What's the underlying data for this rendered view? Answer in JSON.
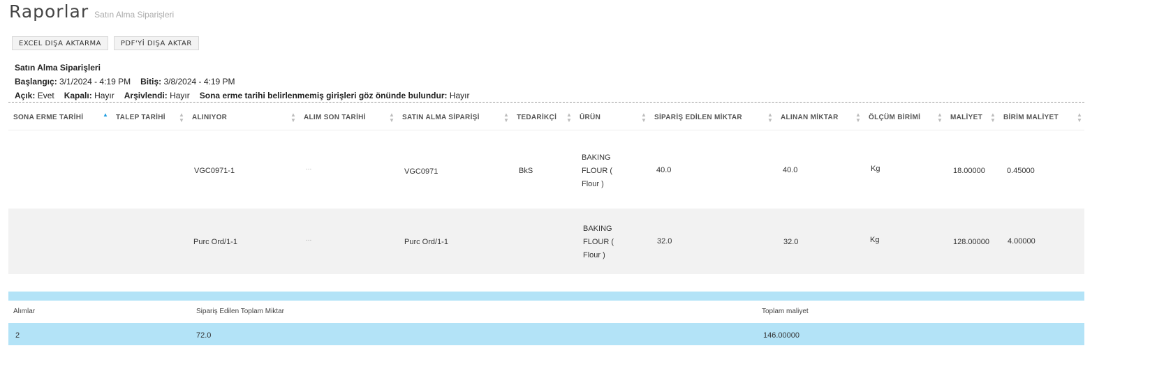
{
  "header": {
    "title": "Raporlar",
    "subtitle": "Satın Alma Siparişleri"
  },
  "toolbar": {
    "excel_label": "EXCEL DIŞA AKTARMA",
    "pdf_label": "PDF'Yİ DIŞA AKTAR"
  },
  "report": {
    "title": "Satın Alma Siparişleri",
    "start_label": "Başlangıç:",
    "start_value": "3/1/2024 - 4:19 PM",
    "end_label": "Bitiş:",
    "end_value": "3/8/2024 - 4:19 PM",
    "open_label": "Açık:",
    "open_value": "Evet",
    "closed_label": "Kapalı:",
    "closed_value": "Hayır",
    "archived_label": "Arşivlendi:",
    "archived_value": "Hayır",
    "noexp_label": "Sona erme tarihi belirlenmemiş girişleri göz önünde bulundur:",
    "noexp_value": "Hayır"
  },
  "table": {
    "columns": [
      "SONA ERME TARİHİ",
      "TALEP TARİHİ",
      "ALINIYOR",
      "ALIM SON TARİHİ",
      "SATIN ALMA SİPARİŞİ",
      "TEDARİKÇİ",
      "ÜRÜN",
      "SİPARİŞ EDİLEN MİKTAR",
      "ALINAN MİKTAR",
      "ÖLÇÜM BİRİMİ",
      "MALİYET",
      "BİRİM MALİYET"
    ],
    "rows": [
      {
        "expiry": "",
        "request": "",
        "receiving": "VGC0971-1",
        "deadline": "...",
        "po": "VGC0971",
        "supplier": "BkS",
        "product": "BAKING FLOUR ( Flour )",
        "ordered": "40.0",
        "received": "40.0",
        "unit": "Kg",
        "cost": "18.00000",
        "unit_cost": "0.45000"
      },
      {
        "expiry": "",
        "request": "",
        "receiving": "Purc Ord/1-1",
        "deadline": "...",
        "po": "Purc Ord/1-1",
        "supplier": "",
        "product": "BAKING FLOUR ( Flour )",
        "ordered": "32.0",
        "received": "32.0",
        "unit": "Kg",
        "cost": "128.00000",
        "unit_cost": "4.00000"
      }
    ]
  },
  "summary": {
    "headers": [
      "Alımlar",
      "Sipariş Edilen Toplam Miktar",
      "Toplam maliyet"
    ],
    "values": [
      "2",
      "72.0",
      "146.00000"
    ]
  },
  "colors": {
    "accent": "#1a9be0",
    "summary_bg": "#b3e3f7",
    "alt_row": "#f2f2f2"
  }
}
